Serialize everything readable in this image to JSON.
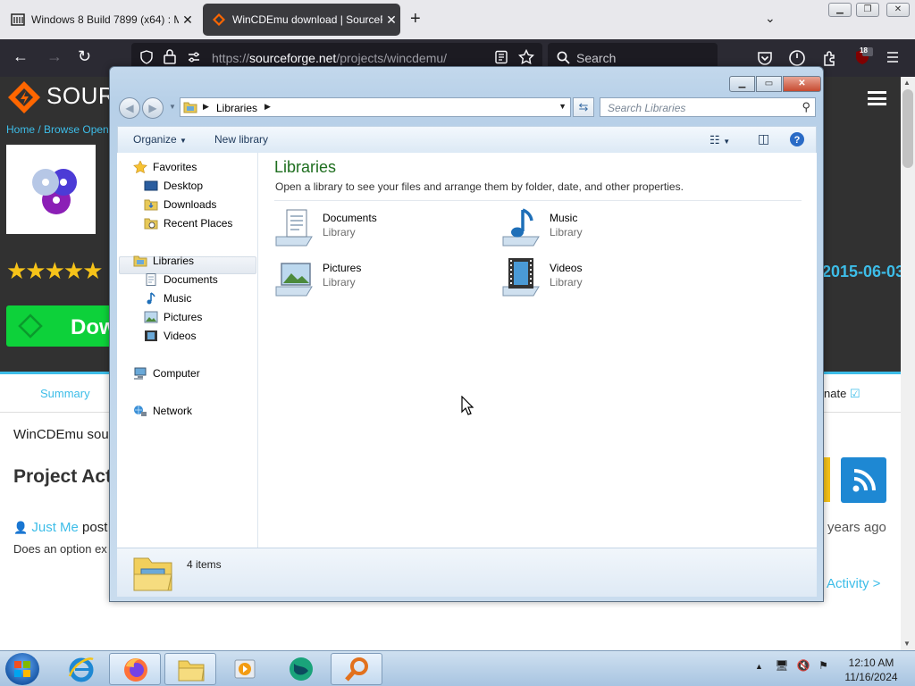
{
  "browser": {
    "tabs": [
      {
        "title": "Windows 8 Build 7899 (x64) : Mi",
        "close": "✕"
      },
      {
        "title": "WinCDEmu download | SourceF",
        "close": "✕"
      }
    ],
    "new_tab": "+",
    "url_prefix": "https://",
    "url_host": "sourceforge.net",
    "url_path": "/projects/wincdemu/",
    "search_placeholder": "Search",
    "badge_count": "18"
  },
  "page": {
    "logo_text": "SOURC",
    "breadcrumb": "Home / Browse Open",
    "download_label": "Dow",
    "date": "2015-06-03",
    "tab_summary": "Summary",
    "tab_donate": "nate",
    "description": "WinCDEmu sou",
    "section_title": "Project Acti",
    "activity_user": "Just Me",
    "activity_suffix": " post",
    "activity_time": "years ago",
    "activity_note": "Does an option ex",
    "more_activity": "Activity >"
  },
  "explorer": {
    "address_label": "Libraries",
    "search_placeholder": "Search Libraries",
    "toolbar": {
      "organize": "Organize",
      "new_library": "New library"
    },
    "nav": {
      "favorites": "Favorites",
      "desktop": "Desktop",
      "downloads": "Downloads",
      "recent": "Recent Places",
      "libraries": "Libraries",
      "documents": "Documents",
      "music": "Music",
      "pictures": "Pictures",
      "videos": "Videos",
      "computer": "Computer",
      "network": "Network"
    },
    "heading": "Libraries",
    "subheading": "Open a library to see your files and arrange them by folder, date, and other properties.",
    "items": [
      {
        "name": "Documents",
        "type": "Library"
      },
      {
        "name": "Music",
        "type": "Library"
      },
      {
        "name": "Pictures",
        "type": "Library"
      },
      {
        "name": "Videos",
        "type": "Library"
      }
    ],
    "status": "4 items"
  },
  "taskbar": {
    "time": "12:10 AM",
    "date": "11/16/2024"
  },
  "colors": {
    "accent_green": "#1e6e1f",
    "sf_blue": "#3dbde8",
    "sf_orange": "#ff6600",
    "download_green": "#0dd13a"
  }
}
